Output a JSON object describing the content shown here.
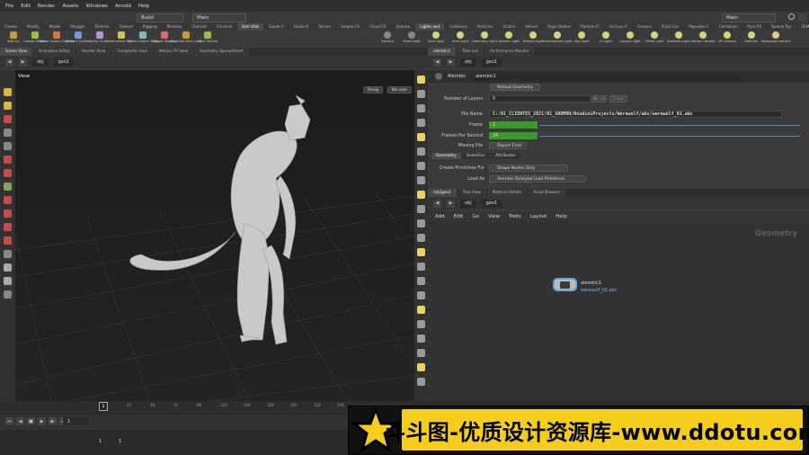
{
  "menubar": {
    "items": [
      "File",
      "Edit",
      "Render",
      "Assets",
      "Windows",
      "Arnold",
      "Help"
    ],
    "desktop": "Build",
    "main": "Main",
    "main_right": "Main"
  },
  "shelf_tabs": [
    "Create",
    "Modify",
    "Model",
    "Polygon",
    "Deform",
    "Texture",
    "Rigging",
    "Muscles",
    "Charact",
    "Constrai",
    "Hair Utils",
    "Guide P",
    "Guide B",
    "Terrain",
    "Simple FX",
    "Cloud FX",
    "Volume",
    "Lights and",
    "Collisions",
    "Particles",
    "Grains",
    "Vellum",
    "Rigid Bodies",
    "Particle Fl",
    "Viscous Fl",
    "Oceans",
    "Fluid Con",
    "Populate C",
    "Container",
    "Pyro FX",
    "Sparse Pyr",
    "FEM",
    "Wires",
    "Crowds",
    "Drive Sim"
  ],
  "shelf_tools_left": [
    "Add Fur",
    "Create Guides",
    "Reuse Groom Objects",
    "Deform Guides",
    "Utility Guides",
    "Generate Hair",
    "Guide Groom Tools",
    "Toggle Display",
    "Generate Hair Cards",
    "Card Texture"
  ],
  "shelf_tools_right": [
    "Camera",
    "Point Light",
    "Spot Light",
    "Area Light",
    "Geometry Light",
    "Volume Light",
    "Distant Light",
    "Environment Light",
    "Sky Light",
    "GI Light",
    "Caustic Light",
    "Portal Light",
    "Ambient Light",
    "Stereo Camera",
    "VR Camera",
    "Switcher",
    "Gamepad Camera"
  ],
  "left_tabs": [
    "Scene View",
    "Animation Editor",
    "Render View",
    "Composite View",
    "Motion FX View",
    "Geometry Spreadsheet"
  ],
  "left_path": {
    "context": "obj",
    "node": "geo1"
  },
  "viewport": {
    "title": "View",
    "persp": "Persp",
    "cam": "No cam"
  },
  "right_tabs": [
    "alembic1",
    "Take List",
    "Performance Monitor"
  ],
  "right_path": {
    "context": "obj",
    "node": "geo1"
  },
  "node_header": {
    "type": "Alembic",
    "name": "alembic1"
  },
  "params": {
    "reload_label": "Reload Geometry",
    "num_layers_label": "Number of Layers",
    "num_layers_value": "0",
    "clear_label": "Clear",
    "file_name_label": "File Name",
    "file_name_value": "C:/01_CLIENTES_2021/01_GNOMON/HoudiniProjects/Werewolf/abc/werewolf_01.abc",
    "frame_label": "Frame",
    "frame_value": "1",
    "fps_label": "Frames Per Second",
    "fps_value": "24",
    "missing_label": "Missing File",
    "missing_value": "Report Error",
    "tabs": [
      "Geometry",
      "Selection",
      "Attributes"
    ],
    "create_prims_label": "Create Primitives For",
    "create_prims_value": "Shape Nodes Only",
    "load_as_label": "Load As",
    "load_as_value": "Alembic Delayed Load Primitives"
  },
  "network_tabs": [
    "/obj/geo1",
    "Tree View",
    "Material Palette",
    "Asset Browser"
  ],
  "network_path": {
    "context": "obj",
    "node": "geo1"
  },
  "network_menu": [
    "Add",
    "Edit",
    "Go",
    "View",
    "Tools",
    "Layout",
    "Help"
  ],
  "network": {
    "label": "Geometry",
    "node_name": "alembic1",
    "node_file": "werewolf_01.abc"
  },
  "timeline": {
    "frame": "1",
    "start": "1",
    "end": "1",
    "ticks": [
      "1",
      "24",
      "48",
      "72",
      "96",
      "120",
      "144",
      "168",
      "192",
      "216",
      "240"
    ]
  },
  "watermark": "斗斗图-优质设计资源库-www.ddotu.com",
  "colors": {
    "accent_green": "#3a9a2a",
    "node_selected": "#6aa6d8",
    "watermark_yellow": "#f5cd1c"
  }
}
